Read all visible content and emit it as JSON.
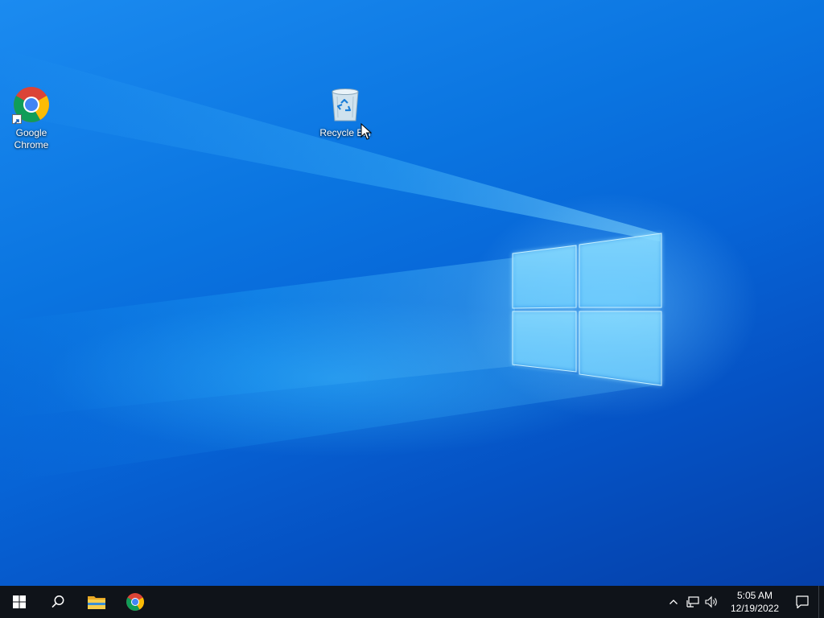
{
  "desktop": {
    "icons": [
      {
        "label": "Google Chrome",
        "icon": "chrome-icon",
        "shortcut": true
      },
      {
        "label": "Recycle Bin",
        "icon": "recycle-bin-icon",
        "shortcut": false
      }
    ]
  },
  "taskbar": {
    "start": {
      "icon": "windows-logo-icon"
    },
    "search": {
      "icon": "search-icon"
    },
    "pinned": [
      {
        "name": "File Explorer",
        "icon": "folder-icon"
      },
      {
        "name": "Google Chrome",
        "icon": "chrome-icon"
      }
    ],
    "tray": {
      "overflow_icon": "chevron-up-icon",
      "network_icon": "network-icon",
      "volume_icon": "speaker-icon",
      "time": "5:05 AM",
      "date": "12/19/2022",
      "notification_icon": "action-center-icon"
    }
  },
  "colors": {
    "taskbar": "#0f1319",
    "wallpaper_primary": "#0a74e0",
    "wallpaper_dark": "#053fa8",
    "logo_glow": "#7fd6ff"
  }
}
